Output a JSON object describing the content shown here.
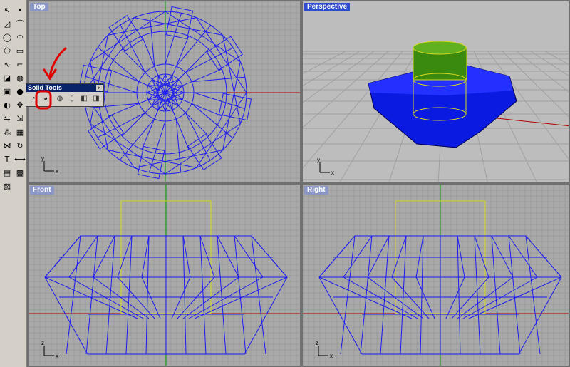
{
  "viewports": {
    "top": {
      "title": "Top"
    },
    "perspective": {
      "title": "Perspective"
    },
    "front": {
      "title": "Front"
    },
    "right": {
      "title": "Right"
    }
  },
  "axes": {
    "top": {
      "x": "x",
      "y": "y"
    },
    "perspective": {
      "x": "x",
      "y": "y"
    },
    "front": {
      "x": "x",
      "z": "z"
    },
    "right": {
      "x": "x",
      "z": "z"
    }
  },
  "solid_toolbar": {
    "title": "Solid Tools",
    "close": "×"
  },
  "colors": {
    "viewport_bg": "#a9a9a9",
    "grid": "#9a9a9a",
    "wire": "#1c1cf0",
    "cylinder": "#d8d820",
    "solid": "#0a1ae0",
    "active_title": "#2e4cd0",
    "annotation": "#e00000"
  },
  "icons": [
    "select-arrow-icon",
    "point-icon",
    "polyline-icon",
    "curve-icon",
    "circle-icon",
    "arc-icon",
    "polygon-icon",
    "rectangle-icon",
    "freeform-icon",
    "fillet-icon",
    "surface-icon",
    "revolve-icon",
    "box-icon",
    "sphere-icon",
    "boolean-icon",
    "move-icon",
    "mirror-icon",
    "scale-icon",
    "array-icon",
    "group-icon",
    "join-icon",
    "transform-icon",
    "text-icon",
    "dimension-icon",
    "layer-icon",
    "render-icon",
    "display-icon"
  ]
}
